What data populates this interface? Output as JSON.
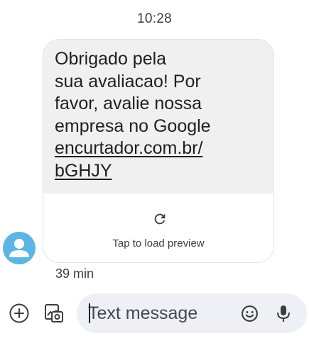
{
  "conversation": {
    "timestamp": "10:28"
  },
  "message": {
    "lines": [
      "Obrigado pela",
      "sua avaliacao! Por",
      "favor, avalie nossa",
      "empresa no Google"
    ],
    "link_lines": [
      "encurtador.com.br/",
      "bGHJY"
    ],
    "preview_label": "Tap to load preview",
    "time": "39 min"
  },
  "compose": {
    "placeholder": "Text message"
  },
  "icons": {
    "avatar": "person-icon",
    "reload": "reload-icon",
    "add": "add-circle-icon",
    "gallery": "gallery-icon",
    "emoji": "emoji-icon",
    "mic": "mic-icon"
  },
  "colors": {
    "bubble_bg": "#f0f0f0",
    "avatar_bg": "#5bb6e6",
    "compose_bg": "#eef0f5",
    "text": "#1f1f1f"
  }
}
